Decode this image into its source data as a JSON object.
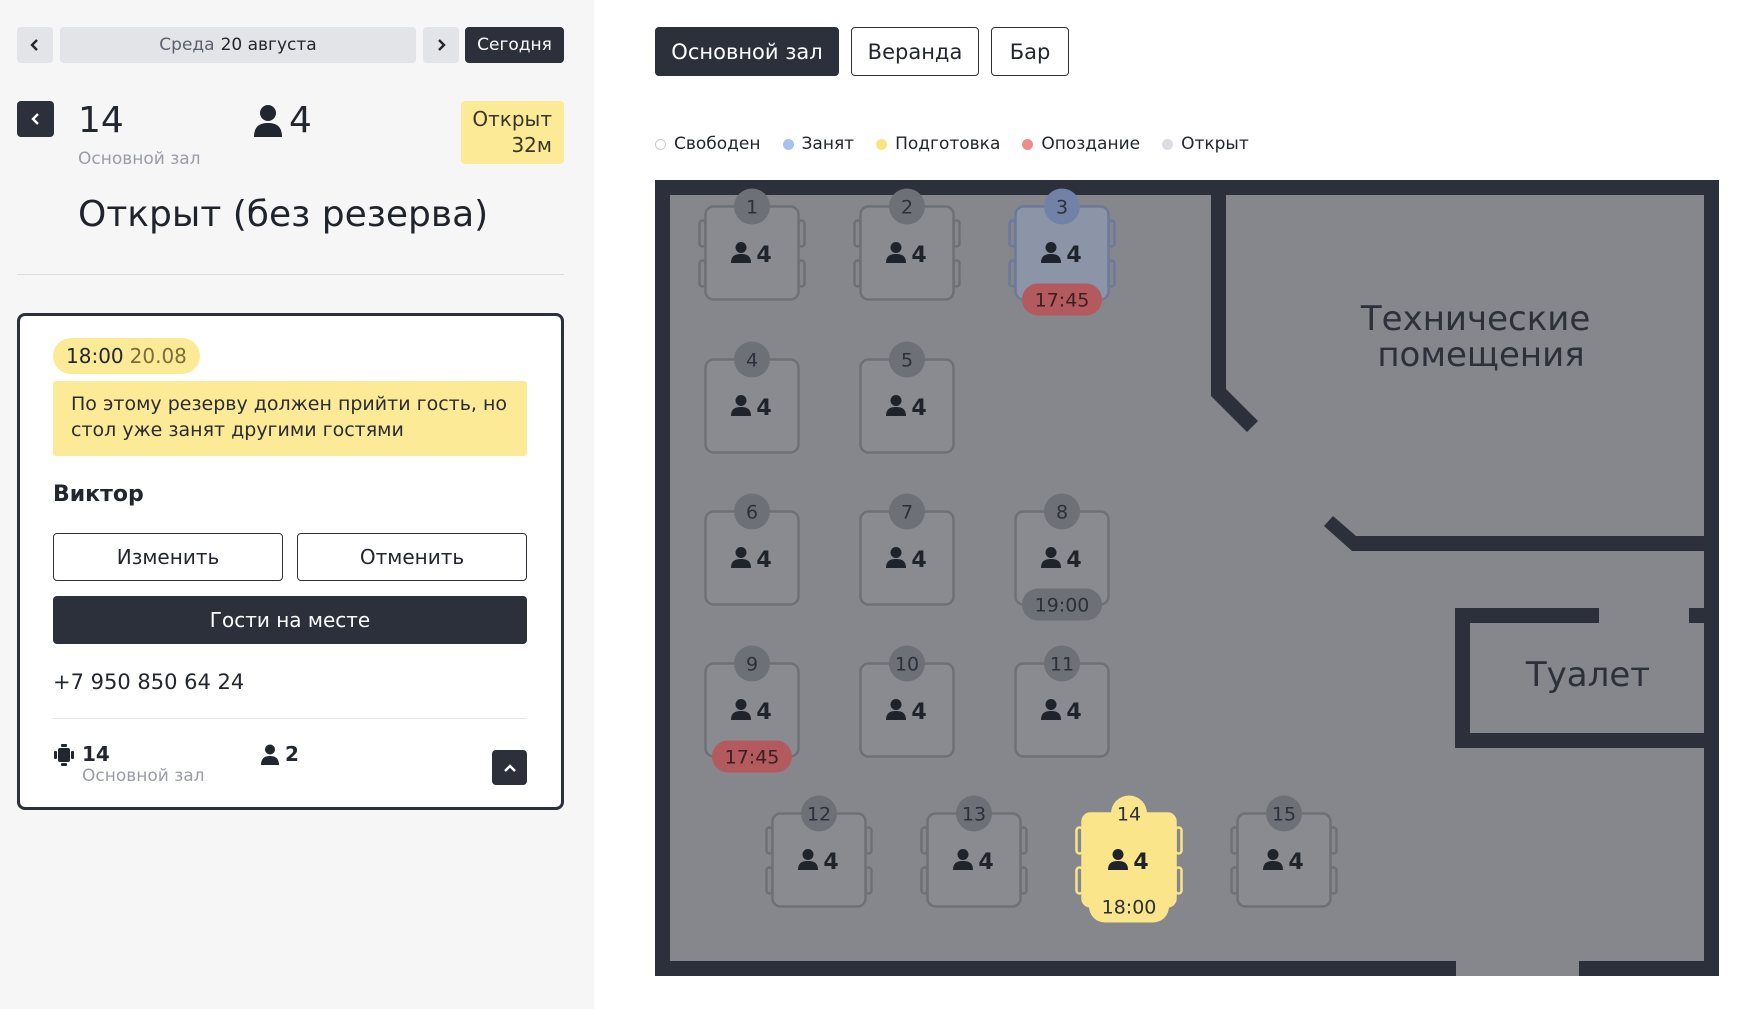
{
  "date_nav": {
    "weekday": "Среда",
    "date": "20 августа",
    "today_label": "Сегодня"
  },
  "table_header": {
    "number": "14",
    "hall": "Основной зал",
    "guests": "4",
    "status_label": "Открыт",
    "status_duration": "32м",
    "status_title": "Открыт (без резерва)"
  },
  "reservation": {
    "time": "18:00",
    "date": "20.08",
    "warning": "По этому резерву должен прийти гость, но стол уже занят другими гостями",
    "guest_name": "Виктор",
    "edit_label": "Изменить",
    "cancel_label": "Отменить",
    "arrived_label": "Гости на месте",
    "phone": "+7 950 850 64 24",
    "table_number": "14",
    "table_hall": "Основной зал",
    "guests": "2"
  },
  "halls": {
    "tabs": [
      "Основной зал",
      "Веранда",
      "Бар"
    ],
    "active": 0
  },
  "legend": [
    {
      "label": "Свободен",
      "color": "#ffffff"
    },
    {
      "label": "Занят",
      "color": "#a9c0ec"
    },
    {
      "label": "Подготовка",
      "color": "#fbe580"
    },
    {
      "label": "Опоздание",
      "color": "#ef8a8a"
    },
    {
      "label": "Открыт",
      "color": "#dcdde2"
    }
  ],
  "floor": {
    "rooms": [
      "Технические\nпомещения",
      "Туалет"
    ],
    "tables": [
      {
        "num": "1",
        "seats": "4",
        "chairs": true
      },
      {
        "num": "2",
        "seats": "4",
        "chairs": true
      },
      {
        "num": "3",
        "seats": "4",
        "chairs": true,
        "state": "busy",
        "tag": "17:45",
        "tag_type": "late"
      },
      {
        "num": "4",
        "seats": "4"
      },
      {
        "num": "5",
        "seats": "4"
      },
      {
        "num": "6",
        "seats": "4"
      },
      {
        "num": "7",
        "seats": "4"
      },
      {
        "num": "8",
        "seats": "4",
        "tag": "19:00",
        "tag_type": "neutral"
      },
      {
        "num": "9",
        "seats": "4",
        "tag": "17:45",
        "tag_type": "late"
      },
      {
        "num": "10",
        "seats": "4"
      },
      {
        "num": "11",
        "seats": "4"
      },
      {
        "num": "12",
        "seats": "4",
        "chairs": true
      },
      {
        "num": "13",
        "seats": "4",
        "chairs": true
      },
      {
        "num": "14",
        "seats": "4",
        "chairs": true,
        "state": "selected",
        "tag": "18:00",
        "tag_type": "prep"
      },
      {
        "num": "15",
        "seats": "4",
        "chairs": true
      }
    ]
  }
}
